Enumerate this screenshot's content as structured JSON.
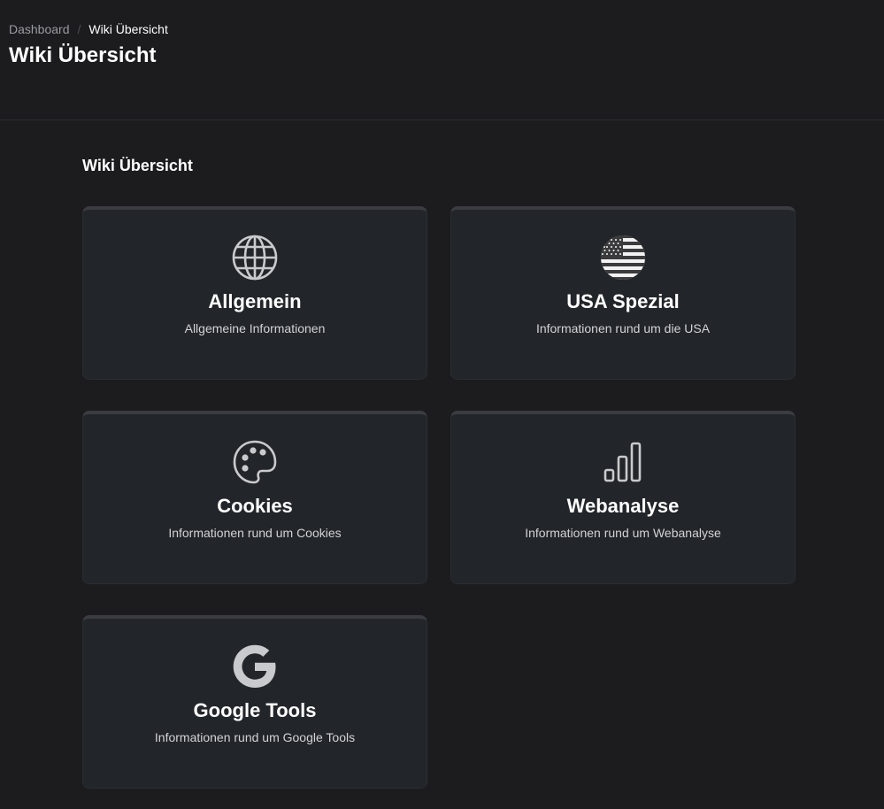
{
  "breadcrumb": {
    "home": "Dashboard",
    "separator": "/",
    "current": "Wiki Übersicht"
  },
  "page": {
    "title": "Wiki Übersicht"
  },
  "section": {
    "title": "Wiki Übersicht"
  },
  "cards": [
    {
      "icon": "globe-icon",
      "title": "Allgemein",
      "description": "Allgemeine Informationen"
    },
    {
      "icon": "usa-flag-icon",
      "title": "USA Spezial",
      "description": "Informationen rund um die USA"
    },
    {
      "icon": "palette-icon",
      "title": "Cookies",
      "description": "Informationen rund um Cookies"
    },
    {
      "icon": "bar-chart-icon",
      "title": "Webanalyse",
      "description": "Informationen rund um Webanalyse"
    },
    {
      "icon": "google-g-icon",
      "title": "Google Tools",
      "description": "Informationen rund um Google Tools"
    }
  ],
  "colors": {
    "background": "#1c1c1e",
    "card_background": "#222529",
    "card_top_border": "#3a3c41",
    "icon": "#c9cacd",
    "text_muted": "#9a9ba0"
  }
}
